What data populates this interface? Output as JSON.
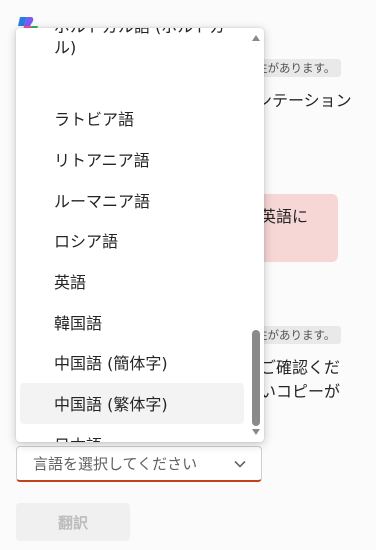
{
  "background": {
    "badge_1": "性があります。",
    "text_1": "ンテーション",
    "alert_text": "英語に",
    "badge_2": "性があります。",
    "text_2": "ご確認くだ",
    "text_3": "いコピーが"
  },
  "language_select": {
    "placeholder": "言語を選択してください"
  },
  "translate_button": {
    "label": "翻訳"
  },
  "dropdown": {
    "options": [
      "ポルトガル語 (ポルトガル)",
      "ラトビア語",
      "リトアニア語",
      "ルーマニア語",
      "ロシア語",
      "英語",
      "韓国語",
      "中国語 (簡体字)",
      "中国語 (繁体字)",
      "日本語"
    ],
    "hovered_option": "中国語 (繁体字)"
  },
  "colors": {
    "accent_underline": "#c4421a",
    "alert_background": "#f6d7d5",
    "hover": "#f3f3f3"
  }
}
